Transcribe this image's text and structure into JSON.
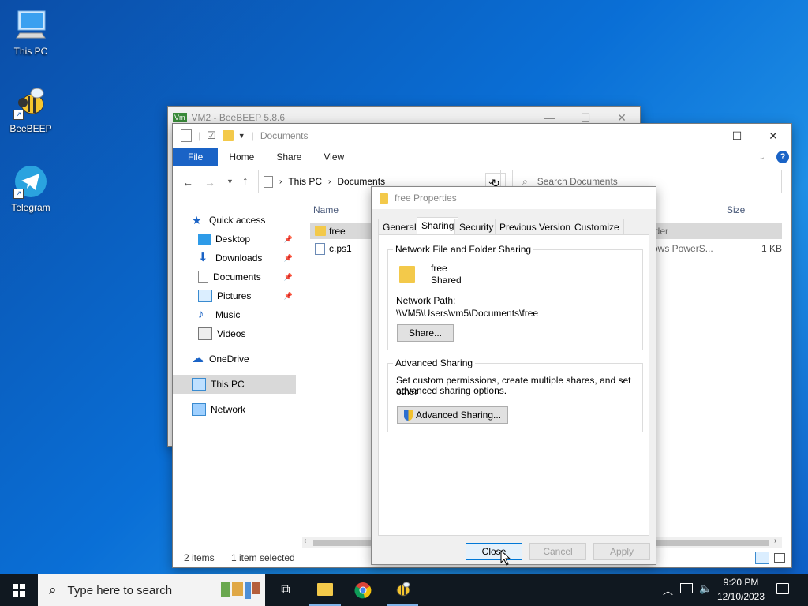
{
  "desktop": {
    "icons": [
      {
        "label": "This PC"
      },
      {
        "label": "BeeBEEP"
      },
      {
        "label": "Telegram"
      }
    ]
  },
  "beebeep_window": {
    "title": "VM2 - BeeBEEP 5.8.6",
    "badge": "Vm"
  },
  "explorer": {
    "title": "Documents",
    "ribbon_tabs": [
      "File",
      "Home",
      "Share",
      "View"
    ],
    "breadcrumb": [
      "This PC",
      "Documents"
    ],
    "search_placeholder": "Search Documents",
    "columns": {
      "name": "Name",
      "size": "Size"
    },
    "files": [
      {
        "name": "free",
        "type_partial": "lder",
        "size": ""
      },
      {
        "name": "c.ps1",
        "type_partial": "ows PowerS...",
        "size": "1 KB"
      }
    ],
    "nav": {
      "quick_access": "Quick access",
      "items": [
        "Desktop",
        "Downloads",
        "Documents",
        "Pictures",
        "Music",
        "Videos"
      ],
      "onedrive": "OneDrive",
      "this_pc": "This PC",
      "network": "Network"
    },
    "status": {
      "items": "2 items",
      "selected": "1 item selected"
    }
  },
  "properties": {
    "title": "free Properties",
    "tabs": [
      "General",
      "Sharing",
      "Security",
      "Previous Versions",
      "Customize"
    ],
    "network_group": "Network File and Folder Sharing",
    "folder_name": "free",
    "folder_state": "Shared",
    "network_path_label": "Network Path:",
    "network_path": "\\\\VM5\\Users\\vm5\\Documents\\free",
    "share_button": "Share...",
    "advanced_group": "Advanced Sharing",
    "advanced_desc_1": "Set custom permissions, create multiple shares, and set other",
    "advanced_desc_2": "advanced sharing options.",
    "advanced_button": "Advanced Sharing...",
    "close": "Close",
    "cancel": "Cancel",
    "apply": "Apply"
  },
  "taskbar": {
    "search_placeholder": "Type here to search",
    "time": "9:20 PM",
    "date": "12/10/2023"
  }
}
